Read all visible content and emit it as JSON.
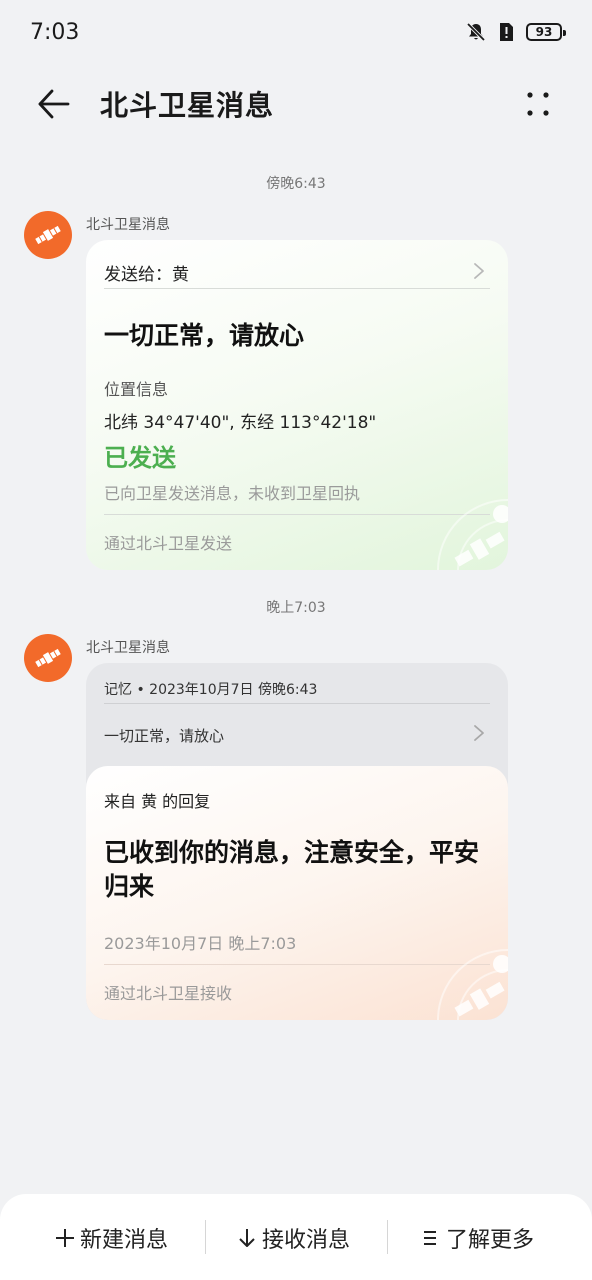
{
  "status_bar": {
    "time": "7:03",
    "battery": "93"
  },
  "header": {
    "title": "北斗卫星消息"
  },
  "thread": [
    {
      "timestamp": "傍晚6:43",
      "sender": "北斗卫星消息",
      "send_to": "发送给：黄",
      "message": "一切正常，请放心",
      "location_label": "位置信息",
      "coordinates": "北纬 34°47'40\", 东经 113°42'18\"",
      "status": "已发送",
      "status_desc": "已向卫星发送消息，未收到卫星回执",
      "via": "通过北斗卫星发送"
    },
    {
      "timestamp": "晚上7:03",
      "sender": "北斗卫星消息",
      "quote_meta": "记忆 • 2023年10月7日 傍晚6:43",
      "quote_text": "一切正常，请放心",
      "reply_from": "来自 黄 的回复",
      "reply_message": "已收到你的消息，注意安全，平安归来",
      "reply_time": "2023年10月7日 晚上7:03",
      "via": "通过北斗卫星接收"
    }
  ],
  "bottom_bar": {
    "new_message": "新建消息",
    "receive_message": "接收消息",
    "learn_more": "了解更多"
  },
  "colors": {
    "accent_orange": "#f26a2a",
    "sent_green": "#4caf50",
    "background": "#f1f2f4"
  }
}
